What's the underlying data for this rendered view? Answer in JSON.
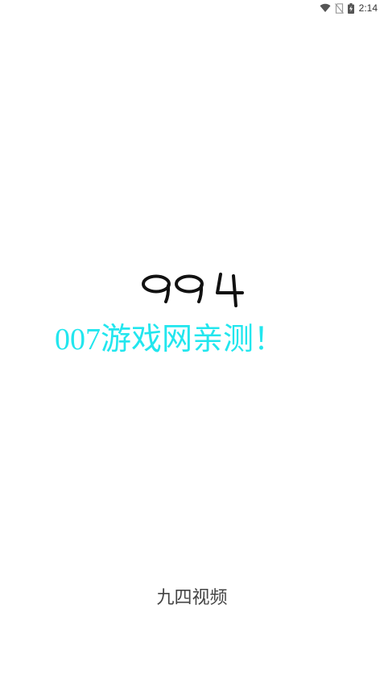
{
  "status_bar": {
    "time": "2:14",
    "icons": [
      "wifi-icon",
      "no-sim-icon",
      "battery-charging-icon"
    ]
  },
  "splash": {
    "logo_text": "994",
    "watermark_text": "007游戏网亲测！",
    "app_name": "九四视频"
  },
  "colors": {
    "background": "#ffffff",
    "logo": "#111111",
    "watermark": "#22e6ee",
    "app_name": "#444444",
    "status_icons": "#555555"
  }
}
